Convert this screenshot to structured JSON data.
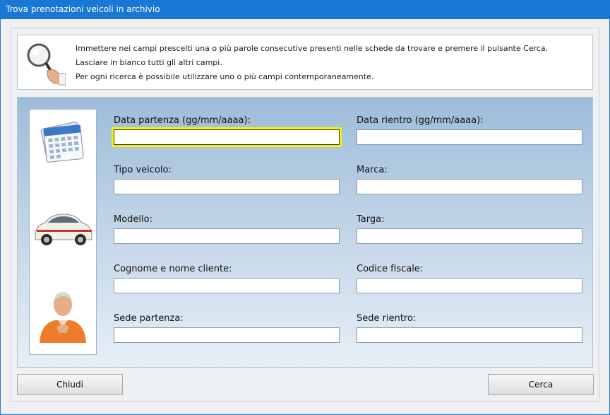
{
  "window": {
    "title": "Trova prenotazioni veicoli in archivio"
  },
  "info": {
    "line1": "Immettere nei campi prescelti una o più parole consecutive presenti nelle schede da trovare e premere il pulsante Cerca.",
    "line2": "Lasciare in bianco tutti gli altri campi.",
    "line3": "Per ogni ricerca è possibile utilizzare uno o più campi contemporaneamente."
  },
  "fields": {
    "data_partenza": {
      "label": "Data partenza (gg/mm/aaaa):",
      "value": ""
    },
    "data_rientro": {
      "label": "Data rientro (gg/mm/aaaa):",
      "value": ""
    },
    "tipo_veicolo": {
      "label": "Tipo veicolo:",
      "value": ""
    },
    "marca": {
      "label": "Marca:",
      "value": ""
    },
    "modello": {
      "label": "Modello:",
      "value": ""
    },
    "targa": {
      "label": "Targa:",
      "value": ""
    },
    "cliente": {
      "label": "Cognome e nome cliente:",
      "value": ""
    },
    "codice_fiscale": {
      "label": "Codice fiscale:",
      "value": ""
    },
    "sede_partenza": {
      "label": "Sede partenza:",
      "value": ""
    },
    "sede_rientro": {
      "label": "Sede rientro:",
      "value": ""
    }
  },
  "buttons": {
    "close": "Chiudi",
    "search": "Cerca"
  },
  "icons": [
    "magnifier-icon",
    "calendar-icon",
    "car-icon",
    "customer-icon"
  ],
  "colors": {
    "titlebar": "#1a78d4",
    "focus_highlight": "#f4f400"
  }
}
